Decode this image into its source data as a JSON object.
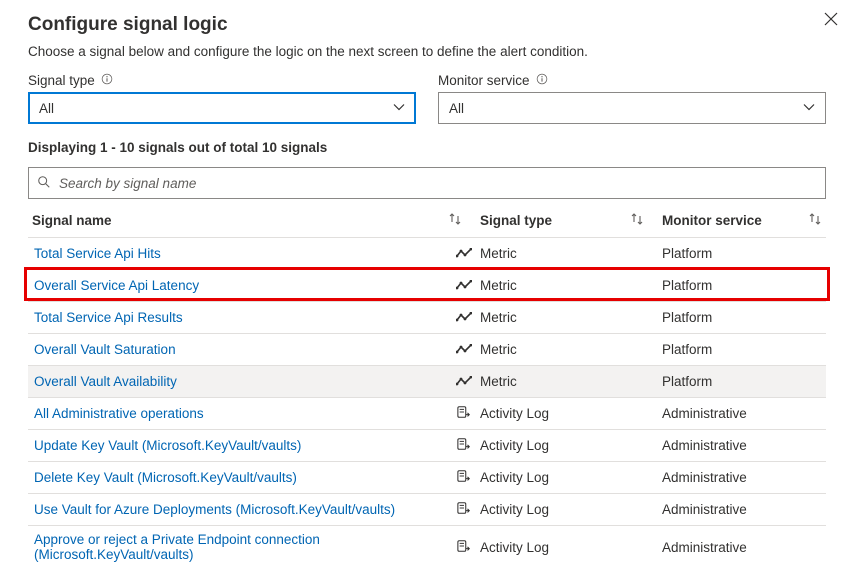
{
  "title": "Configure signal logic",
  "desc": "Choose a signal below and configure the logic on the next screen to define the alert condition.",
  "filters": {
    "signal_type": {
      "label": "Signal type",
      "value": "All"
    },
    "monitor_service": {
      "label": "Monitor service",
      "value": "All"
    }
  },
  "count_text": "Displaying 1 - 10 signals out of total 10 signals",
  "search": {
    "placeholder": "Search by signal name"
  },
  "columns": {
    "name": "Signal name",
    "type": "Signal type",
    "service": "Monitor service"
  },
  "rows": [
    {
      "name": "Total Service Api Hits",
      "icon": "metric",
      "type": "Metric",
      "service": "Platform",
      "highlight": false,
      "hover": false
    },
    {
      "name": "Overall Service Api Latency",
      "icon": "metric",
      "type": "Metric",
      "service": "Platform",
      "highlight": true,
      "hover": false
    },
    {
      "name": "Total Service Api Results",
      "icon": "metric",
      "type": "Metric",
      "service": "Platform",
      "highlight": false,
      "hover": false
    },
    {
      "name": "Overall Vault Saturation",
      "icon": "metric",
      "type": "Metric",
      "service": "Platform",
      "highlight": false,
      "hover": false
    },
    {
      "name": "Overall Vault Availability",
      "icon": "metric",
      "type": "Metric",
      "service": "Platform",
      "highlight": false,
      "hover": true
    },
    {
      "name": "All Administrative operations",
      "icon": "log",
      "type": "Activity Log",
      "service": "Administrative",
      "highlight": false,
      "hover": false
    },
    {
      "name": "Update Key Vault (Microsoft.KeyVault/vaults)",
      "icon": "log",
      "type": "Activity Log",
      "service": "Administrative",
      "highlight": false,
      "hover": false
    },
    {
      "name": "Delete Key Vault (Microsoft.KeyVault/vaults)",
      "icon": "log",
      "type": "Activity Log",
      "service": "Administrative",
      "highlight": false,
      "hover": false
    },
    {
      "name": "Use Vault for Azure Deployments (Microsoft.KeyVault/vaults)",
      "icon": "log",
      "type": "Activity Log",
      "service": "Administrative",
      "highlight": false,
      "hover": false
    },
    {
      "name": "Approve or reject a Private Endpoint connection (Microsoft.KeyVault/vaults)",
      "icon": "log",
      "type": "Activity Log",
      "service": "Administrative",
      "highlight": false,
      "hover": false
    }
  ]
}
